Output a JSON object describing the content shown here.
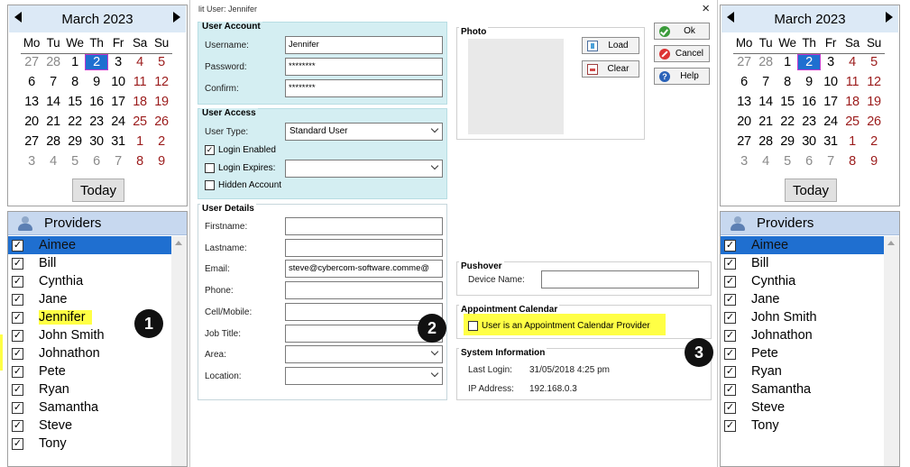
{
  "calendar": {
    "month_label": "March 2023",
    "today_label": "Today",
    "dow": [
      "Mo",
      "Tu",
      "We",
      "Th",
      "Fr",
      "Sa",
      "Su"
    ],
    "weeks": [
      [
        {
          "d": "27",
          "m": true
        },
        {
          "d": "28",
          "m": true
        },
        {
          "d": "1"
        },
        {
          "d": "2",
          "sel": true
        },
        {
          "d": "3"
        },
        {
          "d": "4",
          "w": true
        },
        {
          "d": "5",
          "w": true
        }
      ],
      [
        {
          "d": "6"
        },
        {
          "d": "7"
        },
        {
          "d": "8"
        },
        {
          "d": "9"
        },
        {
          "d": "10"
        },
        {
          "d": "11",
          "w": true
        },
        {
          "d": "12",
          "w": true
        }
      ],
      [
        {
          "d": "13"
        },
        {
          "d": "14"
        },
        {
          "d": "15"
        },
        {
          "d": "16"
        },
        {
          "d": "17"
        },
        {
          "d": "18",
          "w": true
        },
        {
          "d": "19",
          "w": true
        }
      ],
      [
        {
          "d": "20"
        },
        {
          "d": "21"
        },
        {
          "d": "22"
        },
        {
          "d": "23"
        },
        {
          "d": "24"
        },
        {
          "d": "25",
          "w": true
        },
        {
          "d": "26",
          "w": true
        }
      ],
      [
        {
          "d": "27"
        },
        {
          "d": "28"
        },
        {
          "d": "29"
        },
        {
          "d": "30"
        },
        {
          "d": "31"
        },
        {
          "d": "1",
          "w": true
        },
        {
          "d": "2",
          "w": true
        }
      ],
      [
        {
          "d": "3",
          "m": true
        },
        {
          "d": "4",
          "m": true
        },
        {
          "d": "5",
          "m": true
        },
        {
          "d": "6",
          "m": true
        },
        {
          "d": "7",
          "m": true
        },
        {
          "d": "8",
          "w": true
        },
        {
          "d": "9",
          "w": true
        }
      ]
    ]
  },
  "providers": {
    "title": "Providers",
    "left_items": [
      {
        "name": "Aimee",
        "checked": true,
        "selected": true
      },
      {
        "name": "Bill",
        "checked": true
      },
      {
        "name": "Cynthia",
        "checked": true
      },
      {
        "name": "Jane",
        "checked": true
      },
      {
        "name": "Jennifer",
        "checked": true,
        "highlight": true
      },
      {
        "name": "John Smith",
        "checked": true
      },
      {
        "name": "Johnathon",
        "checked": true
      },
      {
        "name": "Pete",
        "checked": true
      },
      {
        "name": "Ryan",
        "checked": true
      },
      {
        "name": "Samantha",
        "checked": true
      },
      {
        "name": "Steve",
        "checked": true
      },
      {
        "name": "Tony",
        "checked": true
      }
    ],
    "right_items": [
      {
        "name": "Aimee",
        "checked": true,
        "selected": true
      },
      {
        "name": "Bill",
        "checked": true
      },
      {
        "name": "Cynthia",
        "checked": true
      },
      {
        "name": "Jane",
        "checked": true
      },
      {
        "name": "John Smith",
        "checked": true
      },
      {
        "name": "Johnathon",
        "checked": true
      },
      {
        "name": "Pete",
        "checked": true
      },
      {
        "name": "Ryan",
        "checked": true
      },
      {
        "name": "Samantha",
        "checked": true
      },
      {
        "name": "Steve",
        "checked": true
      },
      {
        "name": "Tony",
        "checked": true
      }
    ]
  },
  "dialog": {
    "title": "lit User: Jennifer",
    "close_glyph": "×",
    "user_account": {
      "title": "User Account",
      "username_label": "Username:",
      "username_value": "Jennifer",
      "password_label": "Password:",
      "password_value": "********",
      "confirm_label": "Confirm:",
      "confirm_value": "********"
    },
    "user_access": {
      "title": "User Access",
      "type_label": "User Type:",
      "type_value": "Standard User",
      "login_enabled": "Login Enabled",
      "login_expires": "Login Expires:",
      "hidden_account": "Hidden Account"
    },
    "user_details": {
      "title": "User Details",
      "firstname": "Firstname:",
      "lastname": "Lastname:",
      "email": "Email:",
      "email_value": "steve@cybercom-software.comme@",
      "phone": "Phone:",
      "cell": "Cell/Mobile:",
      "job": "Job Title:",
      "area": "Area:",
      "location": "Location:"
    },
    "photo": {
      "title": "Photo",
      "load": "Load",
      "clear": "Clear"
    },
    "buttons": {
      "ok": "Ok",
      "cancel": "Cancel",
      "help": "Help"
    },
    "pushover": {
      "title": "Pushover",
      "device_label": "Device Name:"
    },
    "appointment": {
      "title": "Appointment Calendar",
      "provider_label": "User is an Appointment Calendar Provider"
    },
    "sysinfo": {
      "title": "System Information",
      "last_login_label": "Last Login:",
      "last_login_value": "31/05/2018 4:25 pm",
      "ip_label": "IP Address:",
      "ip_value": "192.168.0.3"
    }
  },
  "badges": [
    "1",
    "2",
    "3"
  ]
}
